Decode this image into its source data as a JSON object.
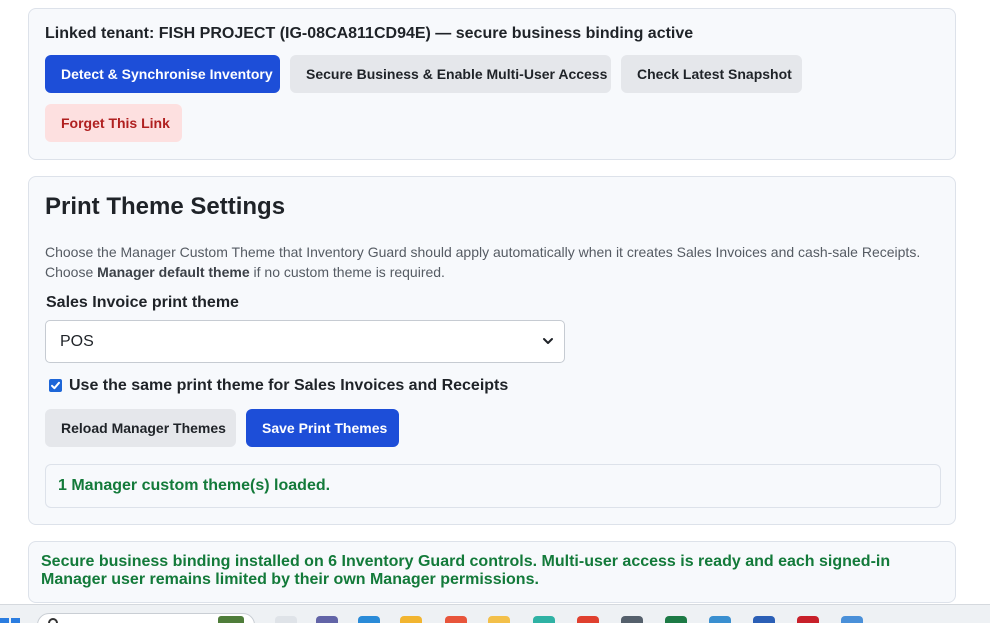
{
  "link_panel": {
    "title": "Linked tenant: FISH PROJECT (IG-08CA811CD94E) — secure business binding active",
    "detect_button": "Detect & Synchronise Inventory",
    "secure_button": "Secure Business & Enable Multi-User Access",
    "snapshot_button": "Check Latest Snapshot",
    "forget_button": "Forget This Link"
  },
  "print_theme": {
    "title": "Print Theme Settings",
    "description_line1": "Choose the Manager Custom Theme that Inventory Guard should apply automatically when it creates Sales Invoices and cash-sale Receipts.",
    "description_choose": "Choose ",
    "description_default": "Manager default theme",
    "description_tail": " if no custom theme is required.",
    "sales_invoice_label": "Sales Invoice print theme",
    "sales_invoice_value": "POS",
    "same_theme_checked": true,
    "same_theme_label": "Use the same print theme for Sales Invoices and Receipts",
    "reload_button": "Reload Manager Themes",
    "save_button": "Save Print Themes",
    "status": "1 Manager custom theme(s) loaded."
  },
  "binding_notice": {
    "text": "Secure business binding installed on 6 Inventory Guard controls. Multi-user access is ready and each signed-in Manager user remains limited by their own Manager permissions."
  },
  "colors": {
    "primary": "#1d4ed8",
    "success_text": "#137a3a",
    "danger_bg": "#fde0e0",
    "danger_text": "#b02020"
  },
  "taskbar": {
    "icons": [
      "windows-start-icon",
      "search-icon",
      "file-explorer-icon",
      "teams-icon",
      "edge-icon",
      "folder-icon",
      "app-icon",
      "app-icon",
      "chrome-icon",
      "app-icon",
      "excel-icon",
      "app-icon",
      "word-icon",
      "acrobat-icon",
      "notepad-icon"
    ]
  }
}
